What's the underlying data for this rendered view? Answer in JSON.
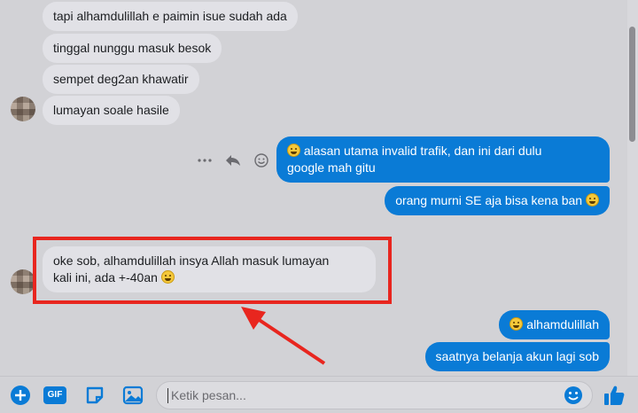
{
  "incoming_top": [
    "tapi alhamdulillah e paimin isue sudah ada",
    "tinggal nunggu masuk besok",
    "sempet deg2an khawatir",
    "lumayan soale hasile"
  ],
  "outgoing_mid": [
    {
      "line1": "alasan utama invalid trafik, dan ini dari dulu",
      "line2": "google mah gitu"
    },
    {
      "line1": "orang murni SE aja bisa kena ban"
    }
  ],
  "highlighted_message": {
    "line1": "oke sob, alhamdulillah insya Allah masuk lumayan",
    "line2": "kali ini, ada +-40an"
  },
  "outgoing_bottom": [
    "alhamdulillah",
    "saatnya belanja akun lagi sob"
  ],
  "composer": {
    "placeholder": "Ketik pesan...",
    "gif_label": "GIF"
  },
  "colors": {
    "outgoing_bubble": "#0a7bd6",
    "incoming_bubble": "#e1e1e6",
    "highlight": "#e8261f",
    "accent": "#0a7bd6"
  },
  "icons": {
    "more": "more-dots-icon",
    "reply": "reply-icon",
    "react": "smiley-icon",
    "add": "plus-circle-icon",
    "sticker": "sticker-icon",
    "photo": "photo-icon",
    "emoji": "emoji-icon",
    "like": "thumbs-up-icon"
  }
}
